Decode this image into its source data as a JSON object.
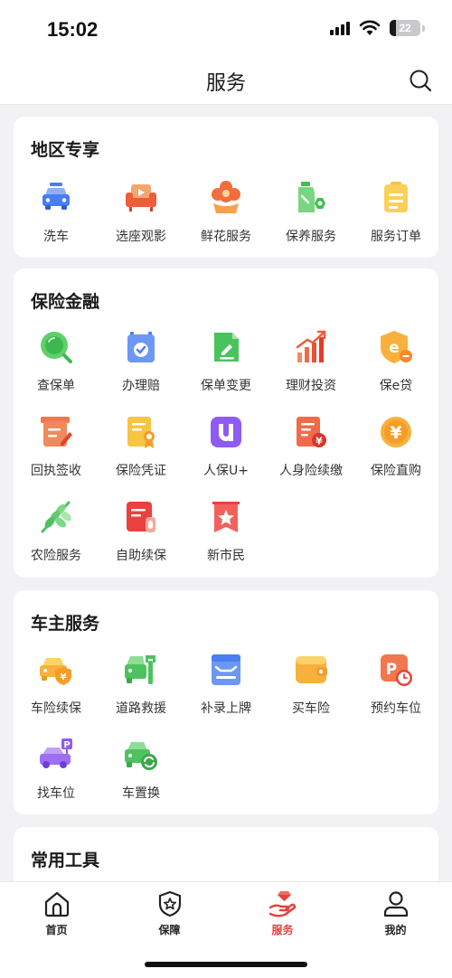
{
  "status": {
    "time": "15:02",
    "battery": "22",
    "battery_level": 0.22
  },
  "nav": {
    "title": "服务"
  },
  "sections": [
    {
      "title": "地区专享",
      "items": [
        {
          "label": "洗车",
          "icon": "car-wash-icon"
        },
        {
          "label": "选座观影",
          "icon": "cinema-seat-icon"
        },
        {
          "label": "鲜花服务",
          "icon": "flower-icon"
        },
        {
          "label": "保养服务",
          "icon": "maintenance-oil-icon"
        },
        {
          "label": "服务订单",
          "icon": "service-order-icon"
        }
      ]
    },
    {
      "title": "保险金融",
      "items": [
        {
          "label": "查保单",
          "icon": "policy-search-icon"
        },
        {
          "label": "办理赔",
          "icon": "claim-icon"
        },
        {
          "label": "保单变更",
          "icon": "policy-change-icon"
        },
        {
          "label": "理财投资",
          "icon": "investment-icon"
        },
        {
          "label": "保e贷",
          "icon": "loan-icon"
        },
        {
          "label": "回执签收",
          "icon": "receipt-sign-icon"
        },
        {
          "label": "保险凭证",
          "icon": "insurance-certificate-icon"
        },
        {
          "label": "人保U+",
          "icon": "picc-u-plus-icon"
        },
        {
          "label": "人身险续缴",
          "icon": "life-insurance-renewal-icon"
        },
        {
          "label": "保险直购",
          "icon": "direct-purchase-icon"
        },
        {
          "label": "农险服务",
          "icon": "agriculture-insurance-icon"
        },
        {
          "label": "自助续保",
          "icon": "self-renewal-icon"
        },
        {
          "label": "新市民",
          "icon": "new-citizen-icon"
        }
      ]
    },
    {
      "title": "车主服务",
      "items": [
        {
          "label": "车险续保",
          "icon": "car-insurance-renewal-icon"
        },
        {
          "label": "道路救援",
          "icon": "road-rescue-icon"
        },
        {
          "label": "补录上牌",
          "icon": "plate-registration-icon"
        },
        {
          "label": "买车险",
          "icon": "buy-car-insurance-icon"
        },
        {
          "label": "预约车位",
          "icon": "parking-reservation-icon"
        },
        {
          "label": "找车位",
          "icon": "find-parking-icon"
        },
        {
          "label": "车置换",
          "icon": "car-exchange-icon"
        }
      ]
    },
    {
      "title": "常用工具",
      "items": []
    }
  ],
  "tabs": [
    {
      "label": "首页",
      "icon": "home-icon",
      "active": false
    },
    {
      "label": "保障",
      "icon": "shield-star-icon",
      "active": false
    },
    {
      "label": "服务",
      "icon": "service-hand-icon",
      "active": true
    },
    {
      "label": "我的",
      "icon": "profile-icon",
      "active": false
    }
  ],
  "colors": {
    "accent": "#e8413e",
    "background": "#f2f2f4",
    "card": "#ffffff"
  }
}
